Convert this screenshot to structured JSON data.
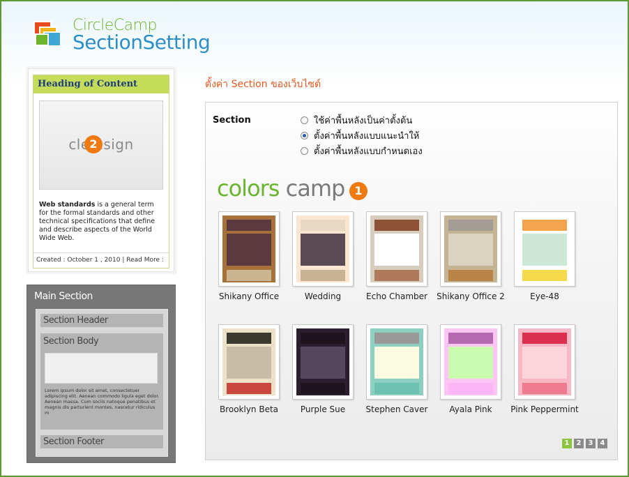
{
  "logo": {
    "top": "CircleCamp",
    "main": "SectionSetting"
  },
  "preview": {
    "heading": "Heading of Content",
    "image_text": "cle   esign",
    "badge": "2",
    "desc_bold": "Web standards",
    "desc_rest": " is a general term for the formal standards and other technical specifications that define and describe aspects of the World Wide Web.",
    "footer": "Created : October 1 , 2010 | Read More :"
  },
  "layout": {
    "title": "Main Section",
    "header": "Section Header",
    "body": "Section Body",
    "body_text": "Lorem ipsum dolor sit amet, consectetuer adipiscing elit. Aenean commodo ligula eget dolor. Aenean massa. Cum sociis natoque penatibus et magnis dis parturient montes, nascetur ridiculus m",
    "footer": "Section Footer"
  },
  "settings_title": "ตั้งค่า Section ของเว็บไซต์",
  "section": {
    "label": "Section",
    "options": [
      {
        "label": "ใช้ค่าพื้นหลังเป็นค่าตั้งต้น",
        "checked": false
      },
      {
        "label": "ตั้งค่าพื้นหลังแบบแนะนำให้",
        "checked": true
      },
      {
        "label": "ตั้งค่าพื้นหลังแบบกำหนดเอง",
        "checked": false
      }
    ]
  },
  "colors_camp": {
    "word1": "colors",
    "word2": "camp",
    "badge": "1"
  },
  "themes": [
    {
      "name": "Shikany Office",
      "bg": "#a8703a",
      "top": "#5a3a3e",
      "mid": "#5a3a3e",
      "bottom": "#c9b68e",
      "frame": "#a8703a"
    },
    {
      "name": "Wedding",
      "bg": "#fbe6d2",
      "top": "#ead9c2",
      "mid": "#5a4a54",
      "bottom": "#c9b193",
      "frame": "#fbe6d2"
    },
    {
      "name": "Echo Chamber",
      "bg": "#d8ccbc",
      "top": "#8b5236",
      "mid": "#ffffff",
      "bottom": "#b07a5a",
      "frame": "#d8ccbc"
    },
    {
      "name": "Shikany Office 2",
      "bg": "#c4b494",
      "top": "#a39c94",
      "mid": "#dcd3c0",
      "bottom": "#b98447",
      "frame": "#c4b494"
    },
    {
      "name": "Eye-48",
      "bg": "#ffffff",
      "top": "#f4a44c",
      "mid": "#cde7d6",
      "bottom": "#f7d94c",
      "frame": "#ffffff"
    },
    {
      "name": "Brooklyn Beta",
      "bg": "#ede1c7",
      "top": "#3a3a30",
      "mid": "#c8bea7",
      "bottom": "#c9473f",
      "frame": "#ede1c7"
    },
    {
      "name": "Purple Sue",
      "bg": "#2c1e2e",
      "top": "#1e141e",
      "mid": "#564760",
      "bottom": "#1e141e",
      "frame": "#2c1e2e"
    },
    {
      "name": "Stephen Caver",
      "bg": "#8ccfc1",
      "top": "#999999",
      "mid": "#fbfbe2",
      "bottom": "#6dc1b1",
      "frame": "#8ccfc1"
    },
    {
      "name": "Ayala Pink",
      "bg": "#fcc5f4",
      "top": "#b56ab0",
      "mid": "#cbfbb0",
      "bottom": "#fcb6f6",
      "frame": "#fcc5f4"
    },
    {
      "name": "Pink Peppermint",
      "bg": "#f7b8c3",
      "top": "#d9304f",
      "mid": "#fcd4dc",
      "bottom": "#ee7b8e",
      "frame": "#f7b8c3"
    }
  ],
  "pager": [
    "1",
    "2",
    "3",
    "4"
  ]
}
